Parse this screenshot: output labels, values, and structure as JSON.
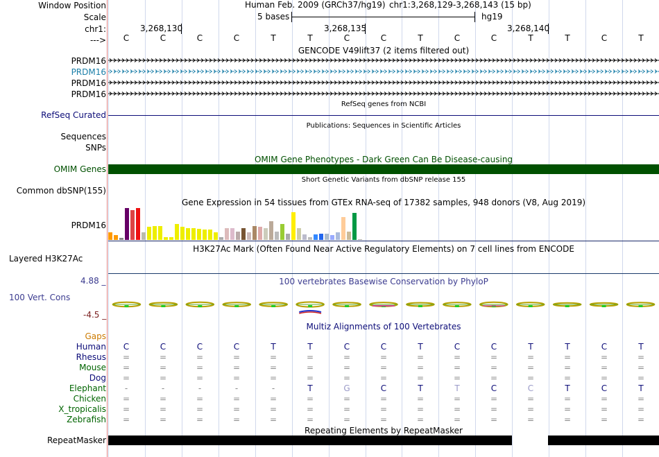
{
  "header": {
    "window_position_label": "Window Position",
    "scale_label": "Scale",
    "chrom_label": "chr1:",
    "strand_label": "--->",
    "assembly_text": "Human Feb. 2009 (GRCh37/hg19)",
    "position_text": "chr1:3,268,129-3,268,143 (15 bp)",
    "scale_text": "5 bases",
    "scale_db": "hg19",
    "coords": [
      "3,268,130",
      "3,268,135",
      "3,268,140"
    ]
  },
  "sequence": [
    "C",
    "C",
    "C",
    "C",
    "T",
    "T",
    "C",
    "C",
    "T",
    "C",
    "C",
    "T",
    "T",
    "C",
    "T"
  ],
  "gencode": {
    "title": "GENCODE V49lift37 (2 items filtered out)",
    "items": [
      {
        "label": "PRDM16",
        "color": "#000000"
      },
      {
        "label": "PRDM16",
        "color": "#1a7ea8"
      },
      {
        "label": "PRDM16",
        "color": "#000000"
      },
      {
        "label": "PRDM16",
        "color": "#000000"
      }
    ]
  },
  "refseq": {
    "label": "RefSeq Curated",
    "title": "RefSeq genes from NCBI",
    "color": "#0c0c78"
  },
  "publications": {
    "title": "Publications: Sequences in Scientific Articles",
    "label_sequences": "Sequences",
    "label_snps": "SNPs"
  },
  "omim": {
    "title": "OMIM Gene Phenotypes - Dark Green Can Be Disease-causing",
    "label": "OMIM Genes",
    "color": "#005000"
  },
  "dbsnp": {
    "label": "Common dbSNP(155)",
    "title": "Short Genetic Variants from dbSNP release 155"
  },
  "gtex": {
    "title": "Gene Expression in 54 tissues from GTEx RNA-seq of 17382 samples, 948 donors (V8, Aug 2019)",
    "label": "PRDM16",
    "bars": [
      {
        "h": 0.23,
        "c": "#ff9900"
      },
      {
        "h": 0.14,
        "c": "#ff9900"
      },
      {
        "h": 0.07,
        "c": "#888888"
      },
      {
        "h": 0.98,
        "c": "#660066"
      },
      {
        "h": 0.91,
        "c": "#dd4444"
      },
      {
        "h": 0.98,
        "c": "#ee1111"
      },
      {
        "h": 0.23,
        "c": "#bbbbaa"
      },
      {
        "h": 0.4,
        "c": "#eeee00"
      },
      {
        "h": 0.43,
        "c": "#eeee00"
      },
      {
        "h": 0.43,
        "c": "#eeee00"
      },
      {
        "h": 0.09,
        "c": "#eeee00"
      },
      {
        "h": 0.09,
        "c": "#eeee00"
      },
      {
        "h": 0.48,
        "c": "#eeee00"
      },
      {
        "h": 0.4,
        "c": "#eeee00"
      },
      {
        "h": 0.37,
        "c": "#eeee00"
      },
      {
        "h": 0.37,
        "c": "#eeee00"
      },
      {
        "h": 0.34,
        "c": "#eeee00"
      },
      {
        "h": 0.31,
        "c": "#eeee00"
      },
      {
        "h": 0.31,
        "c": "#eeee00"
      },
      {
        "h": 0.23,
        "c": "#eeee00"
      },
      {
        "h": 0.09,
        "c": "#aaaaaa"
      },
      {
        "h": 0.37,
        "c": "#ddbbbb"
      },
      {
        "h": 0.37,
        "c": "#ddbbcc"
      },
      {
        "h": 0.26,
        "c": "#bbaaaa"
      },
      {
        "h": 0.37,
        "c": "#775533"
      },
      {
        "h": 0.23,
        "c": "#ccbbbb"
      },
      {
        "h": 0.43,
        "c": "#aa8866"
      },
      {
        "h": 0.4,
        "c": "#ddaaaa"
      },
      {
        "h": 0.37,
        "c": "#ccccbb"
      },
      {
        "h": 0.57,
        "c": "#bbaa99"
      },
      {
        "h": 0.26,
        "c": "#bbbbbb"
      },
      {
        "h": 0.48,
        "c": "#99cc33"
      },
      {
        "h": 0.2,
        "c": "#aaaaaa"
      },
      {
        "h": 0.86,
        "c": "#ffee00"
      },
      {
        "h": 0.37,
        "c": "#ccccaa"
      },
      {
        "h": 0.17,
        "c": "#bbbbcc"
      },
      {
        "h": 0.09,
        "c": "#bbbbbb"
      },
      {
        "h": 0.17,
        "c": "#3388ff"
      },
      {
        "h": 0.2,
        "c": "#2266ee"
      },
      {
        "h": 0.2,
        "c": "#aabbcc"
      },
      {
        "h": 0.14,
        "c": "#99aaff"
      },
      {
        "h": 0.23,
        "c": "#aabbdd"
      },
      {
        "h": 0.71,
        "c": "#ffcc99"
      },
      {
        "h": 0.26,
        "c": "#ccbb99"
      },
      {
        "h": 0.83,
        "c": "#009944"
      },
      {
        "h": 0.03,
        "c": "#aaaaaa"
      }
    ]
  },
  "h3k27ac": {
    "title": "H3K27Ac Mark (Often Found Near Active Regulatory Elements) on 7 cell lines from ENCODE",
    "label": "Layered H3K27Ac"
  },
  "cons": {
    "title": "100 vertebrates Basewise Conservation by PhyloP",
    "label": "100 Vert. Cons",
    "max_label": "4.88 _",
    "min_label": "-4.5 _",
    "label_color": "#3b3b8f",
    "min_color": "#7a1f1f"
  },
  "multiz": {
    "title": "Multiz Alignments of 100 Vertebrates",
    "gaps_label": "Gaps",
    "gaps_color": "#cc7a00",
    "species": [
      {
        "name": "Human",
        "color": "#0c0c78",
        "seq": [
          "C",
          "C",
          "C",
          "C",
          "T",
          "T",
          "C",
          "C",
          "T",
          "C",
          "C",
          "T",
          "T",
          "C",
          "T"
        ]
      },
      {
        "name": "Rhesus",
        "color": "#0c0c78",
        "seq": [
          "=",
          "=",
          "=",
          "=",
          "=",
          "=",
          "=",
          "=",
          "=",
          "=",
          "=",
          "=",
          "=",
          "=",
          "="
        ]
      },
      {
        "name": "Mouse",
        "color": "#006400",
        "seq": [
          "=",
          "=",
          "=",
          "=",
          "=",
          "=",
          "=",
          "=",
          "=",
          "=",
          "=",
          "=",
          "=",
          "=",
          "="
        ]
      },
      {
        "name": "Dog",
        "color": "#0c0c78",
        "seq": [
          "=",
          "=",
          "=",
          "=",
          "=",
          "=",
          "=",
          "=",
          "=",
          "=",
          "=",
          "=",
          "=",
          "=",
          "="
        ]
      },
      {
        "name": "Elephant",
        "color": "#006400",
        "seq": [
          "-",
          "-",
          "-",
          "-",
          "-",
          "T",
          "G",
          "C",
          "T",
          "T",
          "C",
          "C",
          "T",
          "C",
          "T"
        ]
      },
      {
        "name": "Chicken",
        "color": "#006400",
        "seq": [
          "=",
          "=",
          "=",
          "=",
          "=",
          "=",
          "=",
          "=",
          "=",
          "=",
          "=",
          "=",
          "=",
          "=",
          "="
        ]
      },
      {
        "name": "X_tropicalis",
        "color": "#006400",
        "seq": [
          "=",
          "=",
          "=",
          "=",
          "=",
          "=",
          "=",
          "=",
          "=",
          "=",
          "=",
          "=",
          "=",
          "=",
          "="
        ]
      },
      {
        "name": "Zebrafish",
        "color": "#006400",
        "seq": [
          "=",
          "=",
          "=",
          "=",
          "=",
          "=",
          "=",
          "=",
          "=",
          "=",
          "=",
          "=",
          "=",
          "=",
          "="
        ]
      }
    ]
  },
  "repeatmasker": {
    "title": "Repeating Elements by RepeatMasker",
    "label": "RepeatMasker"
  }
}
